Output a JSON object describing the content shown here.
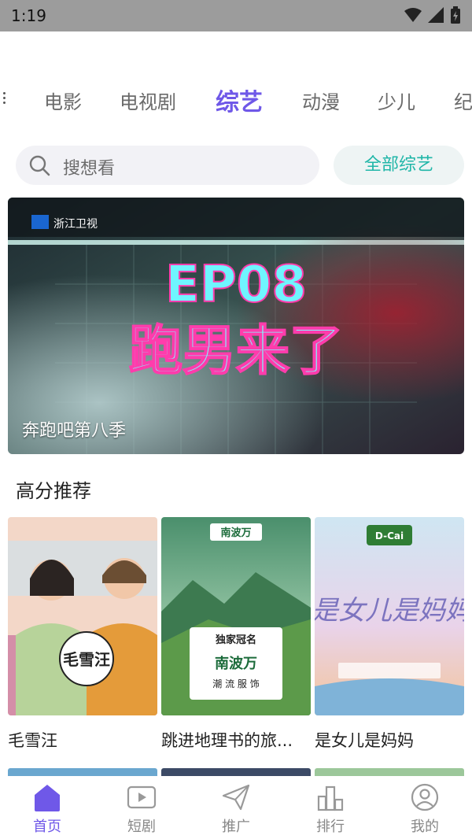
{
  "status_bar": {
    "time": "1:19"
  },
  "tabs": [
    {
      "label": "电影"
    },
    {
      "label": "电视剧"
    },
    {
      "label": "综艺"
    },
    {
      "label": "动漫"
    },
    {
      "label": "少儿"
    },
    {
      "label": "纪"
    }
  ],
  "search": {
    "placeholder": "搜想看"
  },
  "all_button": "全部综艺",
  "banner": {
    "channel_logo": "浙江卫视",
    "episode": "EP08",
    "headline": "跑男来了",
    "caption": "奔跑吧第八季"
  },
  "section": {
    "title": "高分推荐"
  },
  "cards": [
    {
      "title": "毛雪汪",
      "poster_logo": "毛雪汪"
    },
    {
      "title": "跳进地理书的旅...",
      "poster_logo": "南波万",
      "poster_text1": "独家冠名",
      "poster_text2": "潮 流 服 饰"
    },
    {
      "title": "是女儿是妈妈",
      "poster_logo": "D-Cai"
    }
  ],
  "bottom_nav": [
    {
      "label": "首页",
      "icon": "home-icon",
      "active": true
    },
    {
      "label": "短剧",
      "icon": "play-icon"
    },
    {
      "label": "推广",
      "icon": "send-icon"
    },
    {
      "label": "排行",
      "icon": "chart-icon"
    },
    {
      "label": "我的",
      "icon": "user-icon"
    }
  ],
  "colors": {
    "accent": "#6f58e8",
    "teal": "#20b6a8"
  }
}
